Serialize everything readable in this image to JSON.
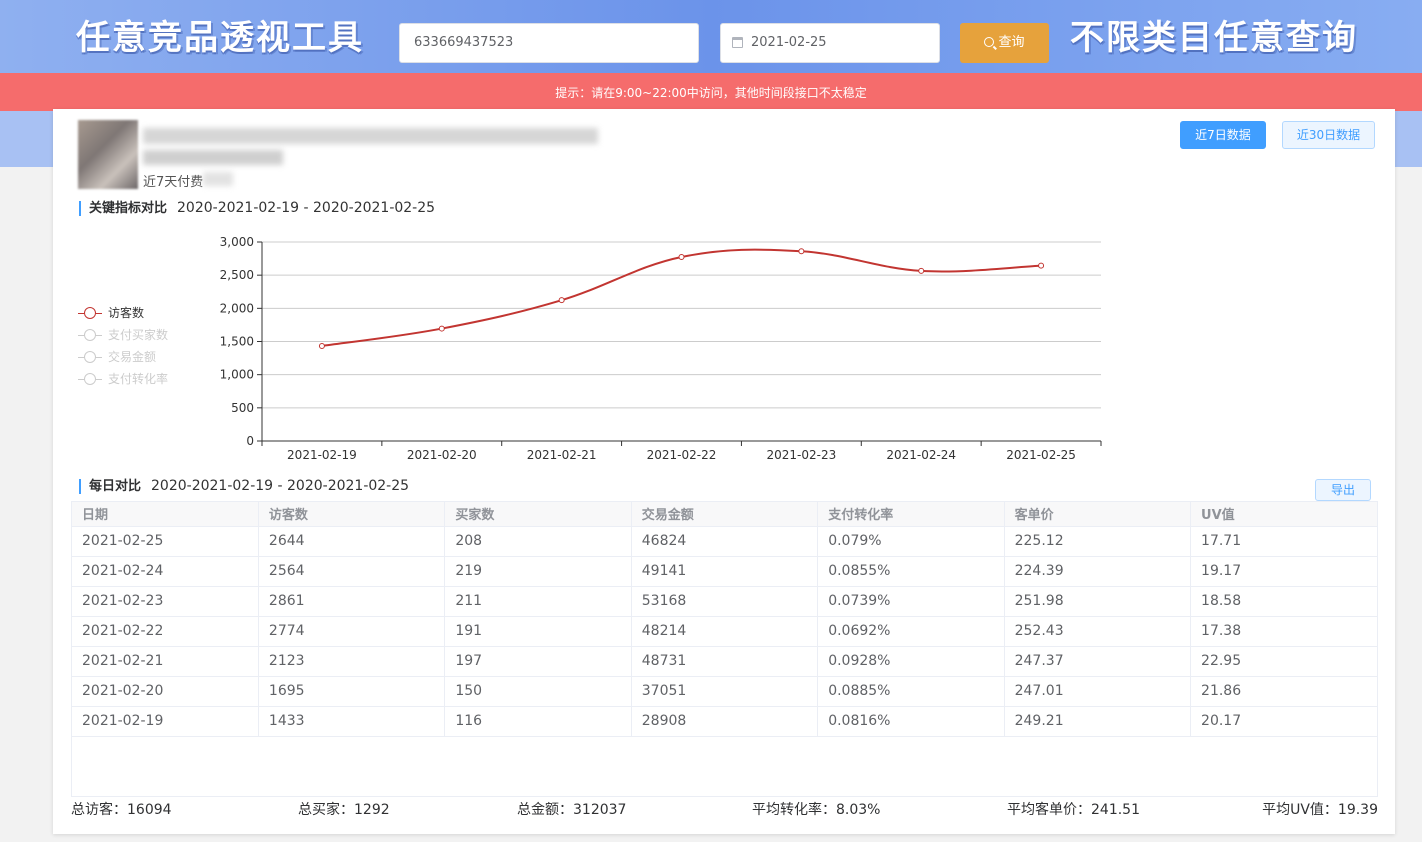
{
  "header": {
    "title_left": "任意竞品透视工具",
    "title_right": "不限类目任意查询",
    "item_id": "633669437523",
    "date": "2021-02-25",
    "query_label": "查询"
  },
  "notice": "提示：请在9:00~22:00中访问，其他时间段接口不太稳定",
  "product": {
    "line3": "近7天付费"
  },
  "range_buttons": {
    "week": "近7日数据",
    "month": "近30日数据"
  },
  "key_metrics": {
    "title": "关键指标对比",
    "range": "2020-2021-02-19 - 2020-2021-02-25"
  },
  "legend": [
    "访客数",
    "支付买家数",
    "交易金额",
    "支付转化率"
  ],
  "chart_data": {
    "type": "line",
    "categories": [
      "2021-02-19",
      "2021-02-20",
      "2021-02-21",
      "2021-02-22",
      "2021-02-23",
      "2021-02-24",
      "2021-02-25"
    ],
    "series": [
      {
        "name": "访客数",
        "values": [
          1433,
          1695,
          2123,
          2774,
          2861,
          2564,
          2644
        ]
      }
    ],
    "ylim": [
      0,
      3000
    ],
    "yticks": [
      0,
      500,
      1000,
      1500,
      2000,
      2500,
      3000
    ],
    "ytick_labels": [
      "0",
      "500",
      "1,000",
      "1,500",
      "2,000",
      "2,500",
      "3,000"
    ],
    "grid": true,
    "legend_position": "left",
    "color": "#c23531"
  },
  "daily": {
    "title": "每日对比",
    "range": "2020-2021-02-19 - 2020-2021-02-25",
    "export_label": "导出",
    "columns": [
      "日期",
      "访客数",
      "买家数",
      "交易金额",
      "支付转化率",
      "客单价",
      "UV值"
    ],
    "rows": [
      [
        "2021-02-25",
        "2644",
        "208",
        "46824",
        "0.079%",
        "225.12",
        "17.71"
      ],
      [
        "2021-02-24",
        "2564",
        "219",
        "49141",
        "0.0855%",
        "224.39",
        "19.17"
      ],
      [
        "2021-02-23",
        "2861",
        "211",
        "53168",
        "0.0739%",
        "251.98",
        "18.58"
      ],
      [
        "2021-02-22",
        "2774",
        "191",
        "48214",
        "0.0692%",
        "252.43",
        "17.38"
      ],
      [
        "2021-02-21",
        "2123",
        "197",
        "48731",
        "0.0928%",
        "247.37",
        "22.95"
      ],
      [
        "2021-02-20",
        "1695",
        "150",
        "37051",
        "0.0885%",
        "247.01",
        "21.86"
      ],
      [
        "2021-02-19",
        "1433",
        "116",
        "28908",
        "0.0816%",
        "249.21",
        "20.17"
      ]
    ]
  },
  "totals": {
    "visitors": "总访客：16094",
    "buyers": "总买家：1292",
    "amount": "总金额：312037",
    "avg_conv": "平均转化率：8.03%",
    "avg_order": "平均客单价：241.51",
    "avg_uv": "平均UV值：19.39"
  }
}
